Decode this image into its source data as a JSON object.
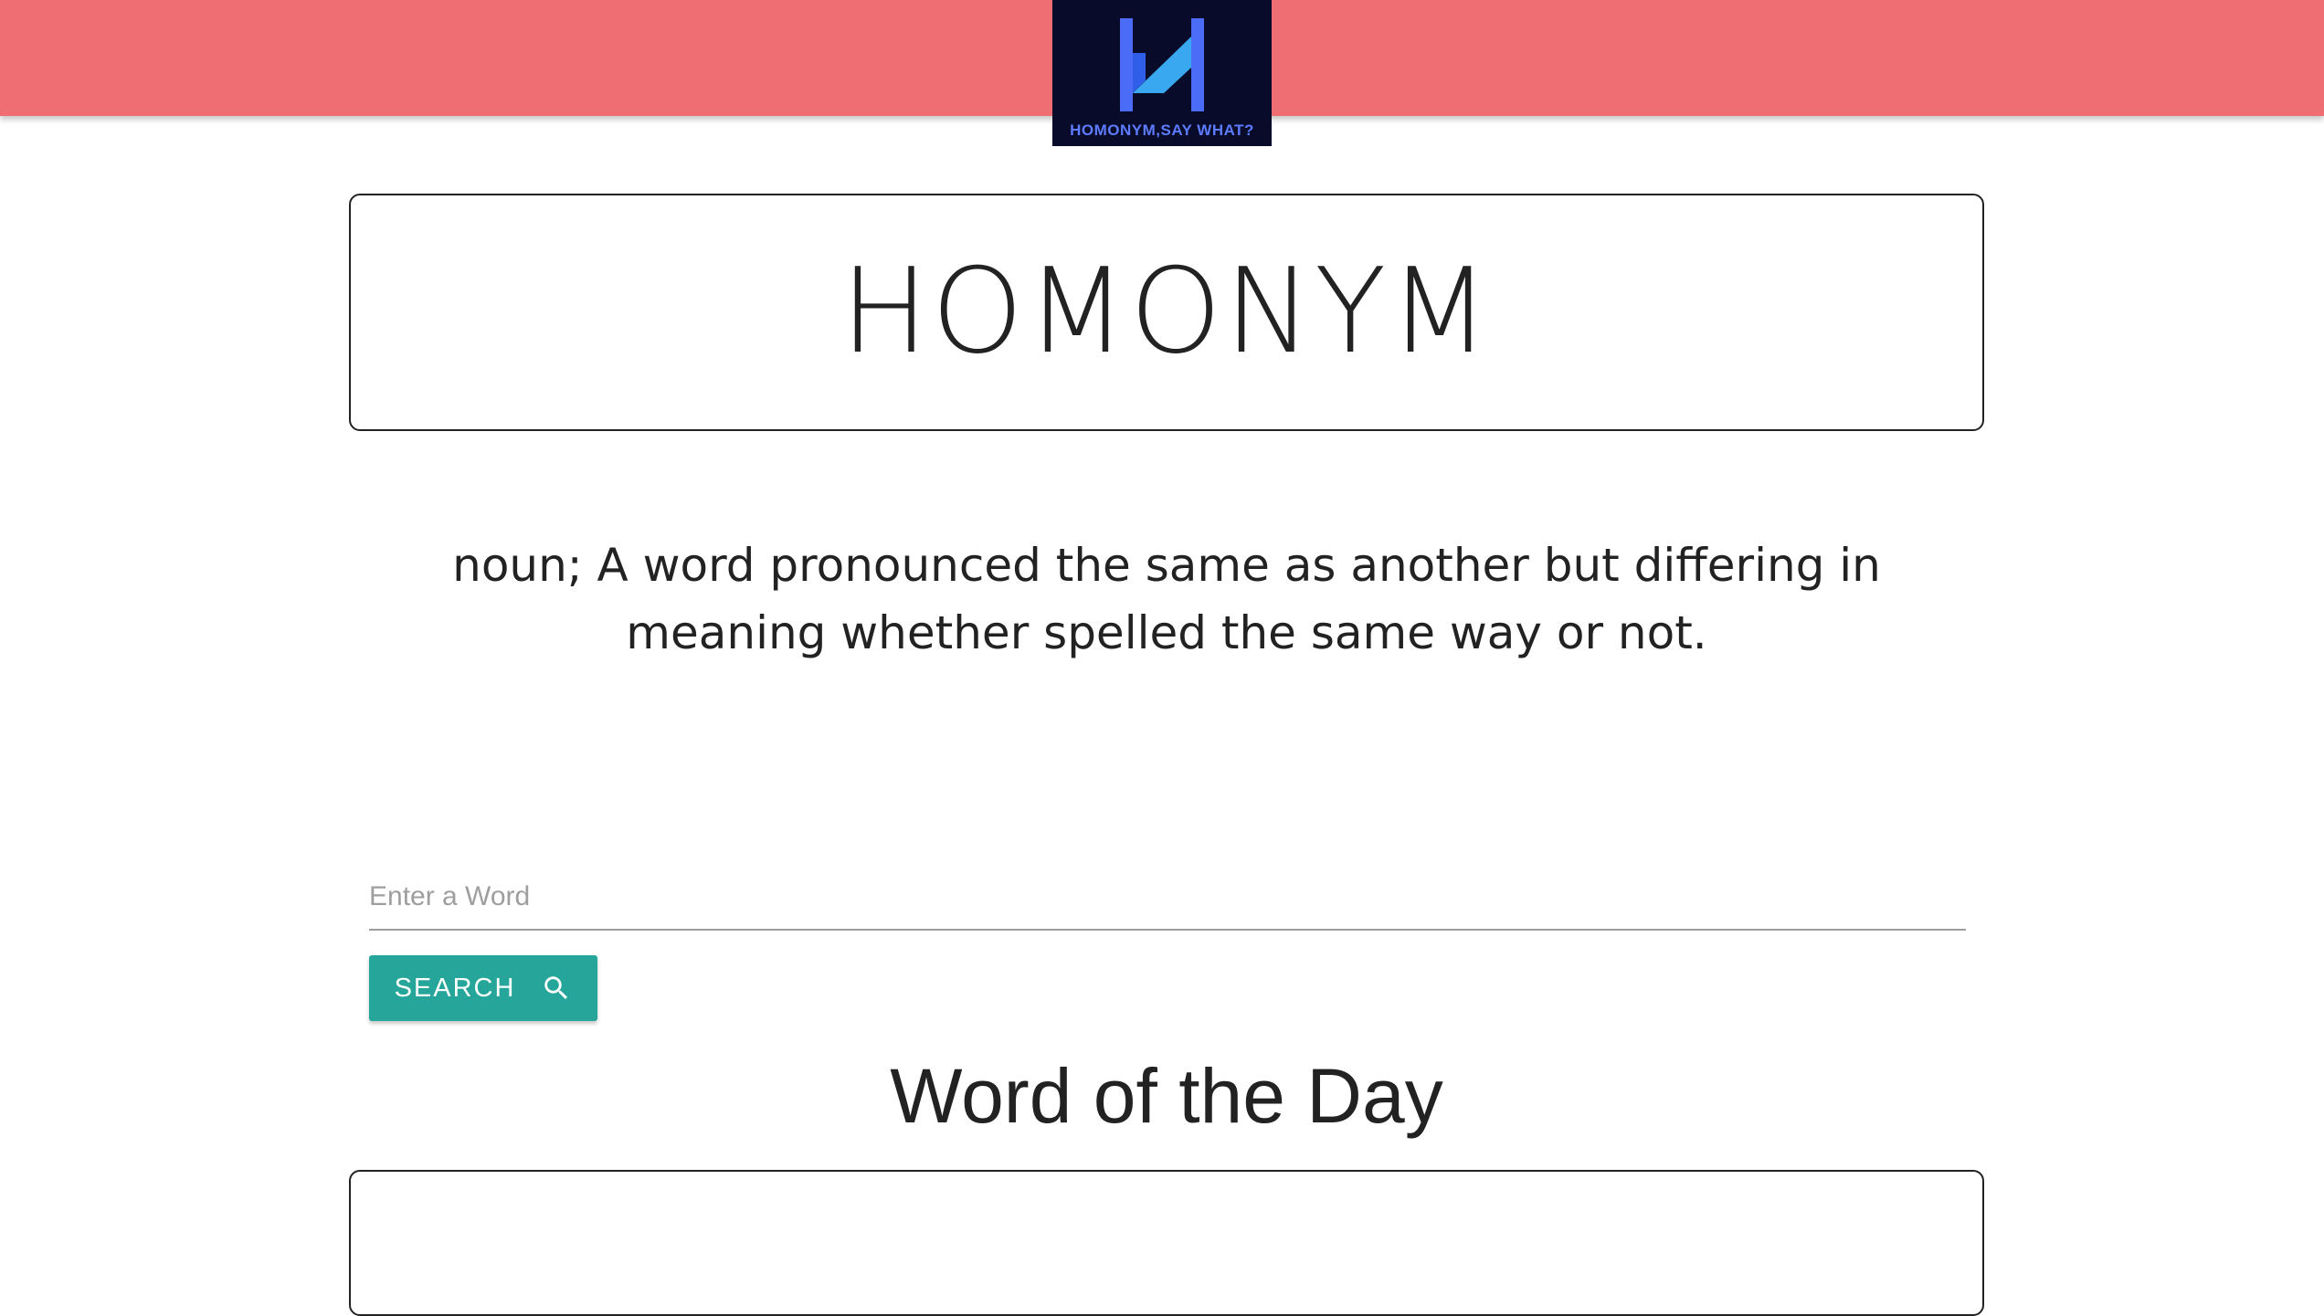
{
  "header": {
    "background_color": "#ee6e73",
    "logo": {
      "icon": "h-monogram-logo-icon",
      "background_color": "#080c2a",
      "text": "HOMONYM,SAY WHAT?"
    }
  },
  "main": {
    "title": "HOMONYM",
    "definition": "noun; A word pronounced the same as another but differing in meaning whether spelled the same way or not."
  },
  "search": {
    "value": "",
    "placeholder": "Enter a Word",
    "button_label": "SEARCH",
    "button_icon": "search-icon",
    "button_color": "#26a69a"
  },
  "word_of_the_day": {
    "heading": "Word of the Day"
  }
}
